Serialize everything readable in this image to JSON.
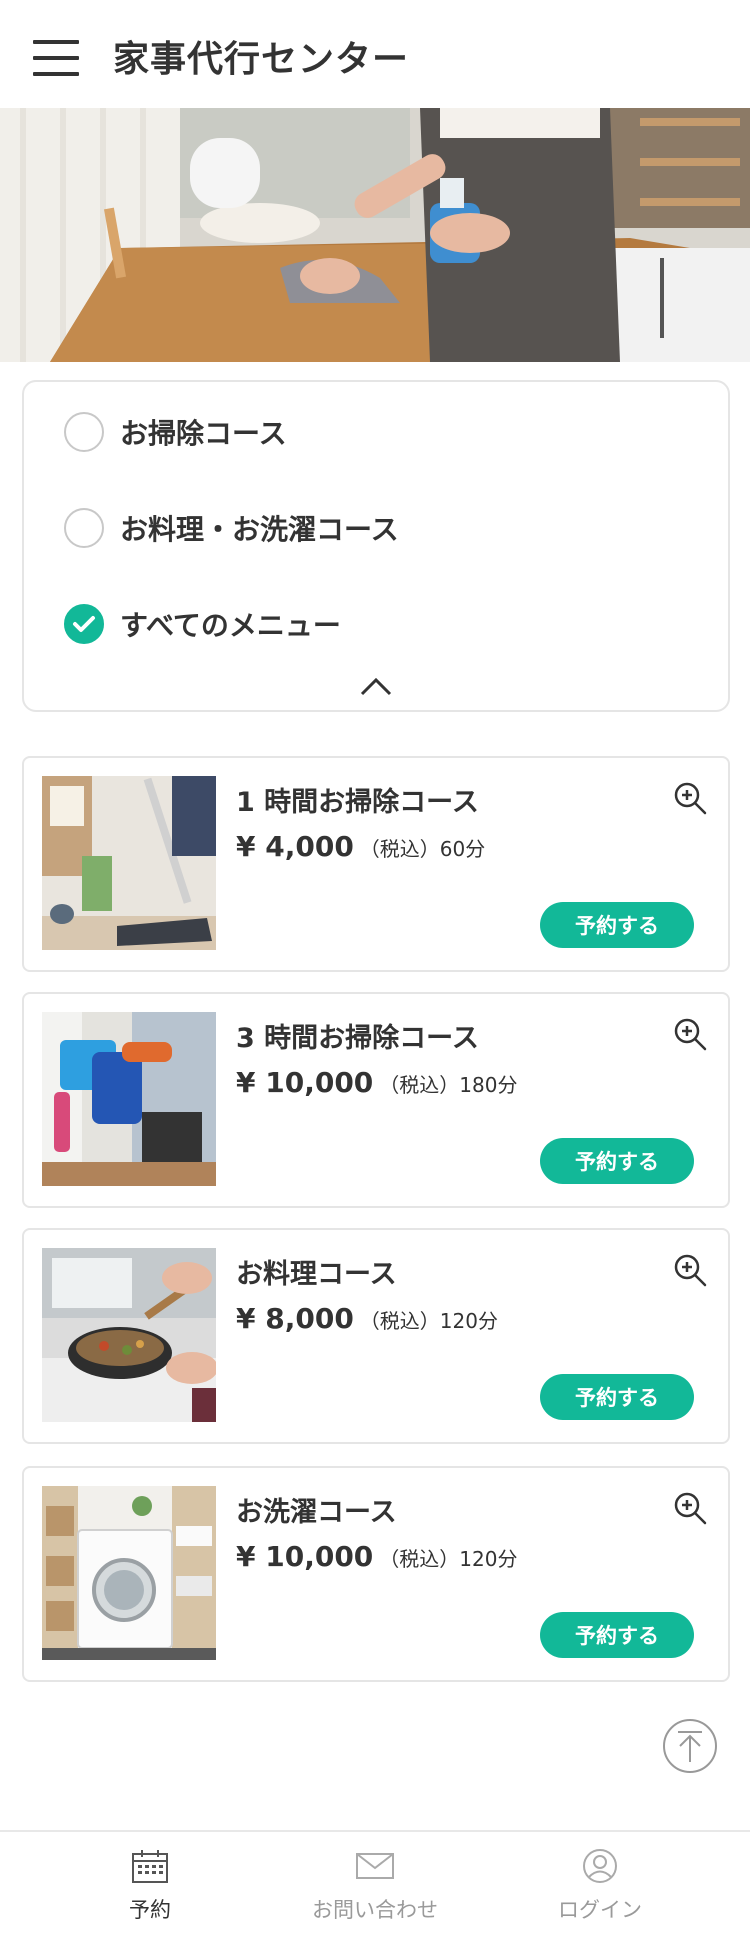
{
  "header": {
    "title": "家事代行センター"
  },
  "filter": {
    "options": [
      {
        "label": "お掃除コース",
        "checked": false
      },
      {
        "label": "お料理・お洗濯コース",
        "checked": false
      },
      {
        "label": "すべてのメニュー",
        "checked": true
      }
    ]
  },
  "courses": [
    {
      "name": "1 時間お掃除コース",
      "price": "¥ 4,000",
      "tax": "（税込）",
      "duration": "60分",
      "button": "予約する"
    },
    {
      "name": "3 時間お掃除コース",
      "price": "¥ 10,000",
      "tax": "（税込）",
      "duration": "180分",
      "button": "予約する"
    },
    {
      "name": "お料理コース",
      "price": "¥ 8,000",
      "tax": "（税込）",
      "duration": "120分",
      "button": "予約する"
    },
    {
      "name": "お洗濯コース",
      "price": "¥ 10,000",
      "tax": "（税込）",
      "duration": "120分",
      "button": "予約する"
    }
  ],
  "bottom_nav": [
    {
      "label": "予約",
      "icon": "calendar-icon",
      "active": true
    },
    {
      "label": "お問い合わせ",
      "icon": "mail-icon",
      "active": false
    },
    {
      "label": "ログイン",
      "icon": "user-icon",
      "active": false
    }
  ],
  "colors": {
    "accent": "#12b898",
    "text": "#333333",
    "muted": "#9a9a9a",
    "border": "#e5e5e5"
  }
}
